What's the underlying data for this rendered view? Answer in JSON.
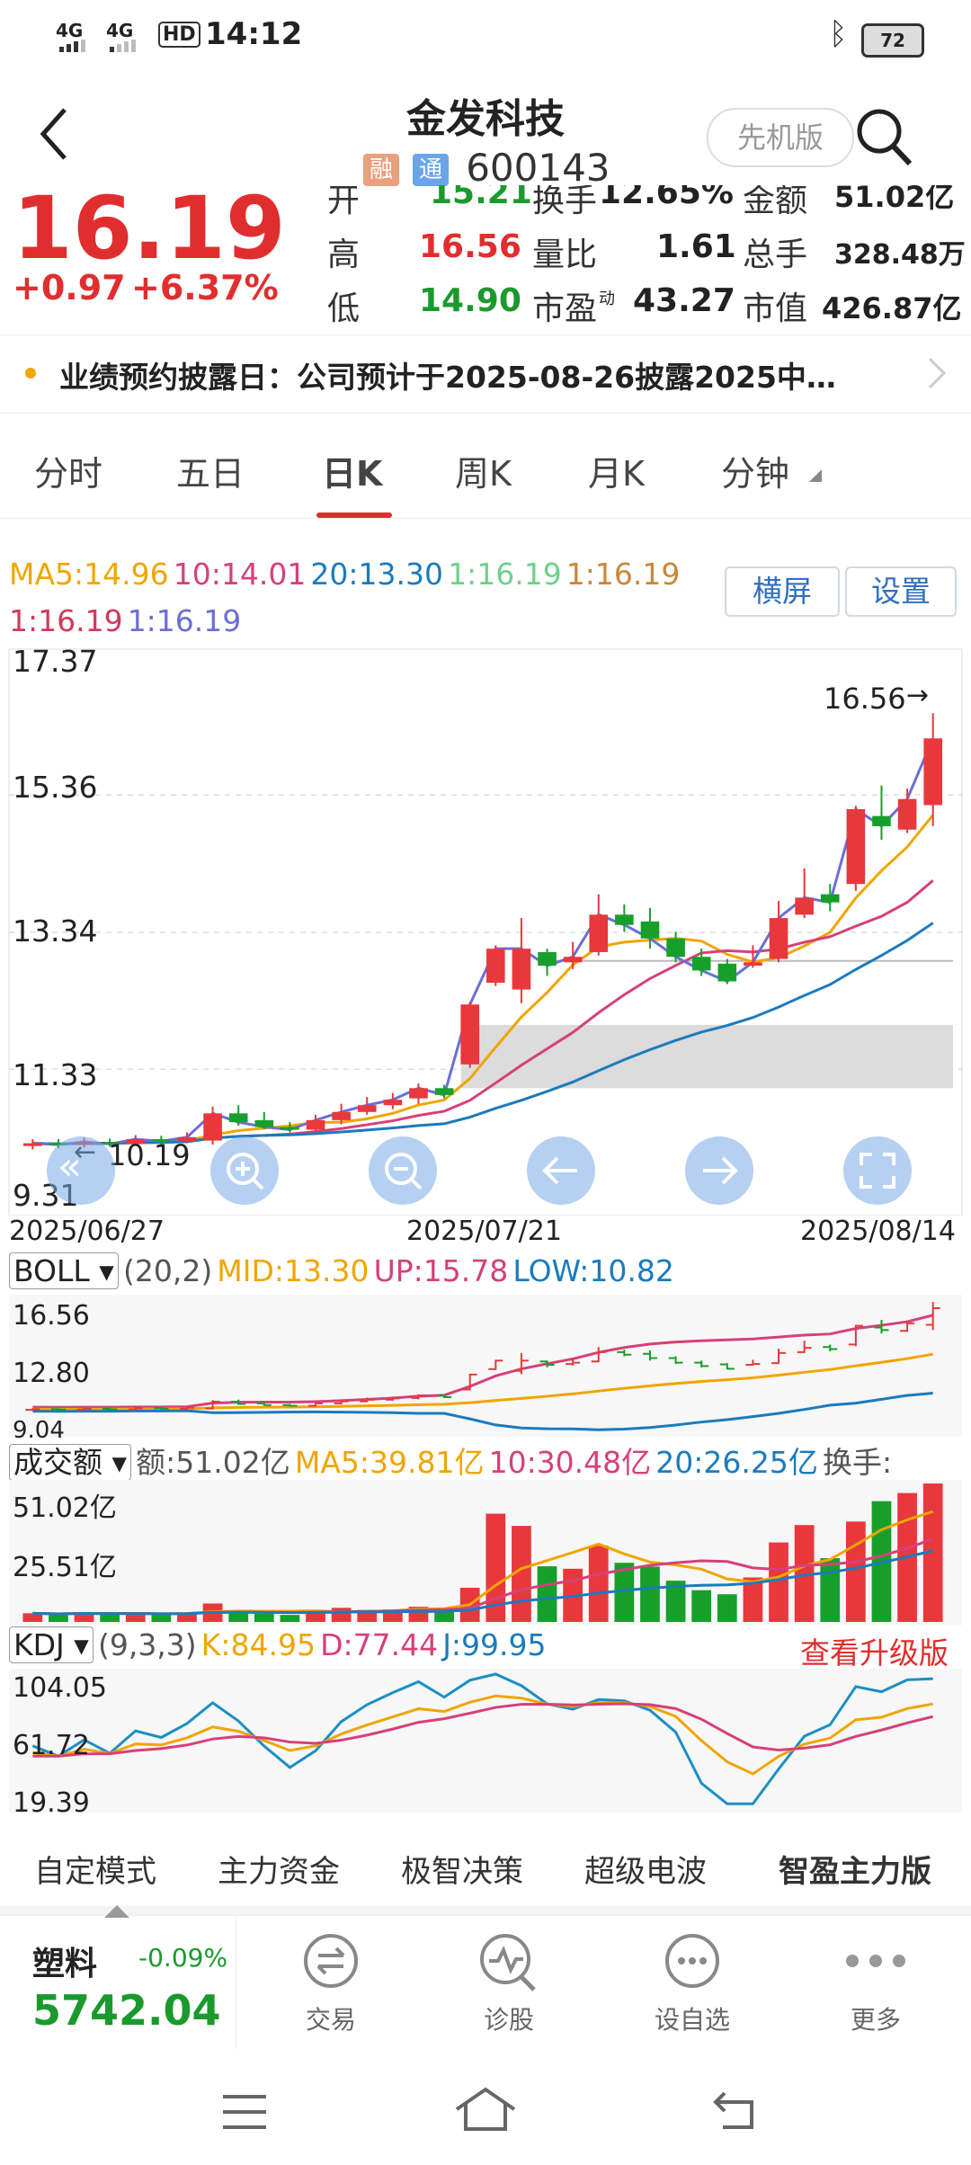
{
  "status_bar": {
    "signal1": "4G",
    "signal2": "4G",
    "hd": "HD",
    "time": "14:12",
    "battery": "72"
  },
  "header": {
    "title": "金发科技",
    "tag_rong": "融",
    "tag_tong": "通",
    "code": "600143",
    "mode_button": "先机版"
  },
  "quote": {
    "price": "16.19",
    "change": "+0.97",
    "change_pct": "+6.37%",
    "open_label": "开",
    "open": "15.21",
    "turnover_label": "换手",
    "turnover": "12.65%",
    "amount_label": "金额",
    "amount": "51.02亿",
    "high_label": "高",
    "high": "16.56",
    "vol_ratio_label": "量比",
    "vol_ratio": "1.61",
    "total_hands_label": "总手",
    "total_hands": "328.48万",
    "low_label": "低",
    "low": "14.90",
    "pe_label": "市盈",
    "pe_sup": "动",
    "pe": "43.27",
    "mktcap_label": "市值",
    "mktcap": "426.87亿"
  },
  "notice": {
    "text": "业绩预约披露日：公司预计于2025-08-26披露2025中…"
  },
  "tabs": [
    "分时",
    "五日",
    "日K",
    "周K",
    "月K",
    "分钟"
  ],
  "active_tab": "日K",
  "ma_legend": {
    "ma5": "MA5:14.96",
    "ma10": "10:14.01",
    "ma20": "20:13.30",
    "l1": "1:16.19",
    "l2": "1:16.19",
    "l3": "1:16.19",
    "l4": "1:16.19",
    "landscape_btn": "横屏",
    "settings_btn": "设置"
  },
  "price_axis": {
    "y1": "17.37",
    "y2": "15.36",
    "y3": "13.34",
    "y4": "11.33",
    "y5": "9.31",
    "max_marker": "16.56",
    "min_marker": "10.19",
    "d1": "2025/06/27",
    "d2": "2025/07/21",
    "d3": "2025/08/14"
  },
  "boll": {
    "name": "BOLL",
    "params": "(20,2)",
    "mid": "MID:13.30",
    "up": "UP:15.78",
    "low": "LOW:10.82",
    "y1": "16.56",
    "y2": "12.80",
    "y3": "9.04"
  },
  "volume": {
    "name": "成交额",
    "amount": "额:51.02亿",
    "ma5": "MA5:39.81亿",
    "ma10": "10:30.48亿",
    "ma20": "20:26.25亿",
    "turnover": "换手:",
    "y1": "51.02亿",
    "y2": "25.51亿"
  },
  "kdj": {
    "name": "KDJ",
    "params": "(9,3,3)",
    "k": "K:84.95",
    "d": "D:77.44",
    "j": "J:99.95",
    "upgrade": "查看升级版",
    "y1": "104.05",
    "y2": "61.72",
    "y3": "19.39"
  },
  "bottom_menu": [
    "自定模式",
    "主力资金",
    "极智决策",
    "超级电波",
    "智盈主力版"
  ],
  "index_ticker": {
    "name": "塑料",
    "change": "-0.09%",
    "value": "5742.04"
  },
  "dock": [
    "交易",
    "诊股",
    "设自选",
    "更多"
  ],
  "chart_data": {
    "type": "candlestick",
    "x_start": "2025/06/27",
    "x_mid": "2025/07/21",
    "x_end": "2025/08/14",
    "ylim": [
      9.31,
      17.37
    ],
    "candles": [
      {
        "o": 10.2,
        "c": 10.24,
        "h": 10.3,
        "l": 10.15
      },
      {
        "o": 10.24,
        "c": 10.22,
        "h": 10.3,
        "l": 10.17
      },
      {
        "o": 10.22,
        "c": 10.26,
        "h": 10.32,
        "l": 10.18
      },
      {
        "o": 10.26,
        "c": 10.23,
        "h": 10.31,
        "l": 10.19
      },
      {
        "o": 10.23,
        "c": 10.3,
        "h": 10.36,
        "l": 10.2
      },
      {
        "o": 10.3,
        "c": 10.27,
        "h": 10.35,
        "l": 10.22
      },
      {
        "o": 10.27,
        "c": 10.33,
        "h": 10.4,
        "l": 10.24
      },
      {
        "o": 10.28,
        "c": 10.68,
        "h": 10.78,
        "l": 10.22
      },
      {
        "o": 10.68,
        "c": 10.55,
        "h": 10.8,
        "l": 10.5
      },
      {
        "o": 10.58,
        "c": 10.48,
        "h": 10.7,
        "l": 10.45
      },
      {
        "o": 10.48,
        "c": 10.44,
        "h": 10.55,
        "l": 10.4
      },
      {
        "o": 10.44,
        "c": 10.58,
        "h": 10.66,
        "l": 10.4
      },
      {
        "o": 10.58,
        "c": 10.7,
        "h": 10.82,
        "l": 10.52
      },
      {
        "o": 10.7,
        "c": 10.8,
        "h": 10.92,
        "l": 10.66
      },
      {
        "o": 10.8,
        "c": 10.88,
        "h": 10.98,
        "l": 10.74
      },
      {
        "o": 10.9,
        "c": 11.05,
        "h": 11.12,
        "l": 10.82
      },
      {
        "o": 11.05,
        "c": 10.95,
        "h": 11.1,
        "l": 10.9
      },
      {
        "o": 11.4,
        "c": 12.28,
        "h": 12.32,
        "l": 11.35
      },
      {
        "o": 12.6,
        "c": 13.1,
        "h": 13.15,
        "l": 12.55
      },
      {
        "o": 12.5,
        "c": 13.1,
        "h": 13.55,
        "l": 12.3
      },
      {
        "o": 13.05,
        "c": 12.85,
        "h": 13.1,
        "l": 12.7
      },
      {
        "o": 12.9,
        "c": 12.98,
        "h": 13.2,
        "l": 12.8
      },
      {
        "o": 13.05,
        "c": 13.6,
        "h": 13.9,
        "l": 13.0
      },
      {
        "o": 13.6,
        "c": 13.45,
        "h": 13.75,
        "l": 13.35
      },
      {
        "o": 13.5,
        "c": 13.25,
        "h": 13.7,
        "l": 13.1
      },
      {
        "o": 13.25,
        "c": 12.98,
        "h": 13.35,
        "l": 12.9
      },
      {
        "o": 12.98,
        "c": 12.78,
        "h": 13.1,
        "l": 12.7
      },
      {
        "o": 12.88,
        "c": 12.62,
        "h": 12.95,
        "l": 12.58
      },
      {
        "o": 12.85,
        "c": 12.9,
        "h": 13.15,
        "l": 12.82
      },
      {
        "o": 12.95,
        "c": 13.55,
        "h": 13.8,
        "l": 12.9
      },
      {
        "o": 13.6,
        "c": 13.85,
        "h": 14.28,
        "l": 13.55
      },
      {
        "o": 13.9,
        "c": 13.78,
        "h": 14.05,
        "l": 13.65
      },
      {
        "o": 14.05,
        "c": 15.15,
        "h": 15.2,
        "l": 13.95
      },
      {
        "o": 15.05,
        "c": 14.9,
        "h": 15.5,
        "l": 14.7
      },
      {
        "o": 14.85,
        "c": 15.3,
        "h": 15.45,
        "l": 14.8
      },
      {
        "o": 15.21,
        "c": 16.19,
        "h": 16.56,
        "l": 14.9
      }
    ],
    "boll_mid_last": 13.3,
    "boll_up_last": 15.78,
    "boll_low_last": 10.82,
    "volume_yi": [
      3.2,
      2.8,
      3.5,
      2.9,
      3.1,
      2.7,
      3.3,
      6.8,
      4.1,
      3.0,
      2.6,
      3.9,
      5.2,
      4.4,
      4.6,
      5.6,
      4.8,
      12.6,
      39.9,
      35.4,
      20.5,
      19.6,
      28.1,
      21.8,
      20.4,
      15.2,
      11.7,
      10.2,
      16.4,
      29.3,
      35.7,
      23.5,
      37.0,
      44.5,
      47.5,
      51.02
    ],
    "kdj_k_last": 84.95,
    "kdj_d_last": 77.44,
    "kdj_j_last": 99.95
  }
}
